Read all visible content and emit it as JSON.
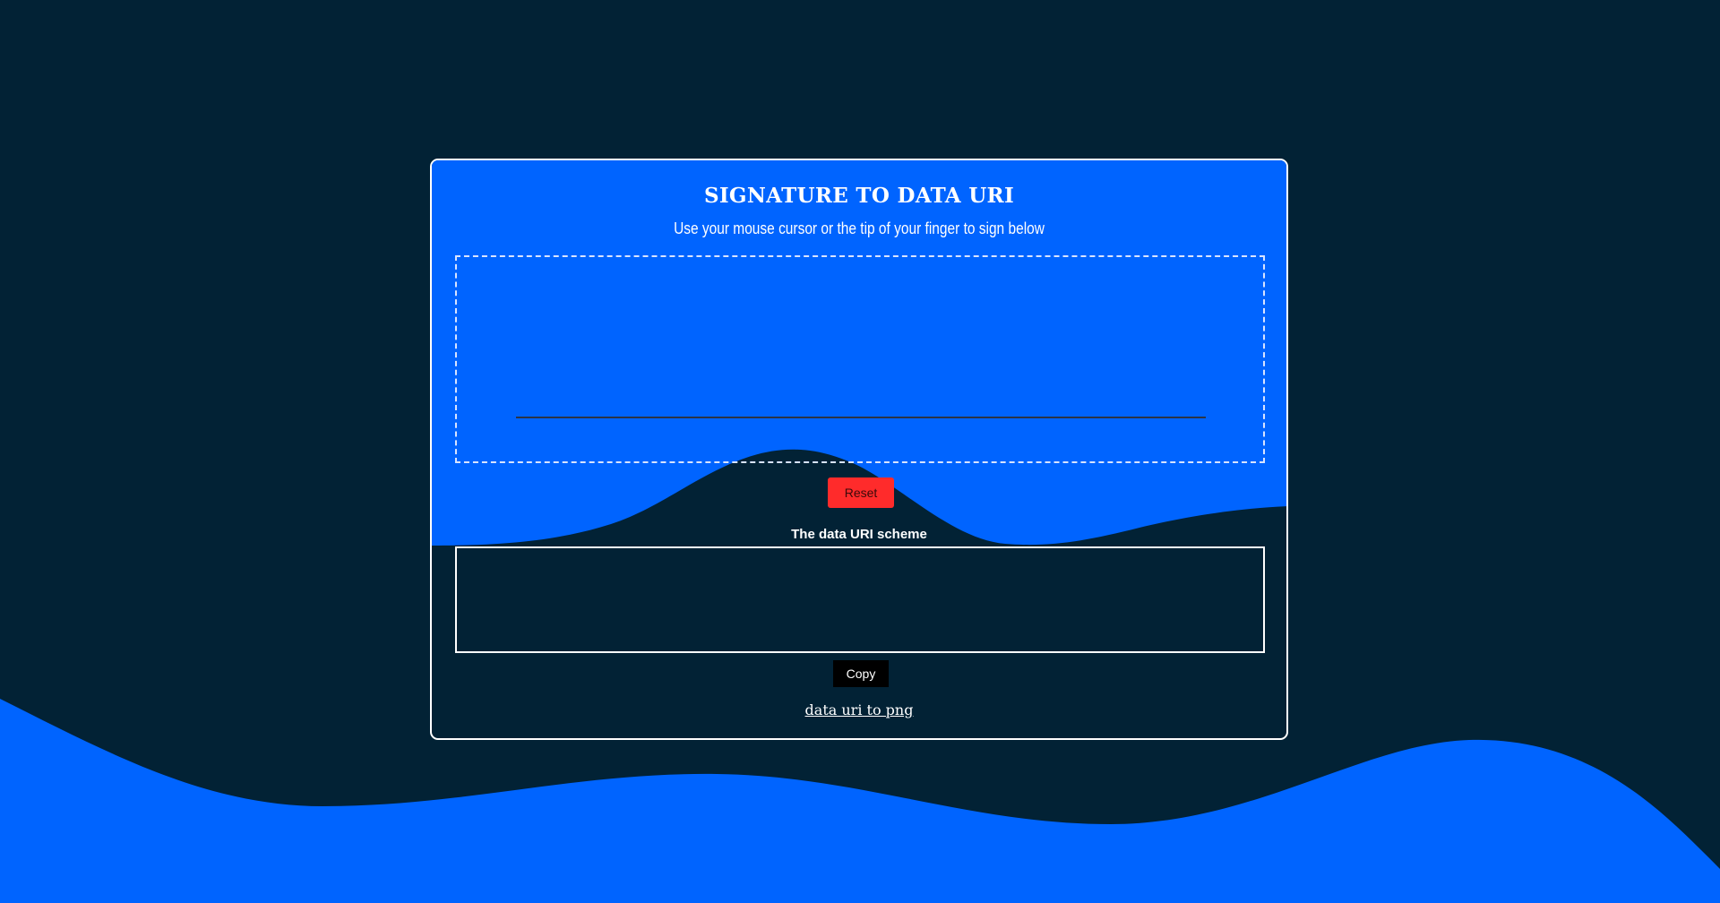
{
  "app": {
    "title": "SIGNATURE TO DATA URI",
    "subtitle": "Use your mouse cursor or the tip of your finger to sign below"
  },
  "signature_pad": {
    "reset_label": "Reset"
  },
  "data_uri": {
    "label": "The data URI scheme",
    "value": "",
    "copy_label": "Copy"
  },
  "footer": {
    "link_text": "data uri to png"
  },
  "colors": {
    "background": "#022235",
    "accent_blue": "#0064ff",
    "reset_red": "#ff2b2b",
    "border_white": "#ffffff"
  }
}
